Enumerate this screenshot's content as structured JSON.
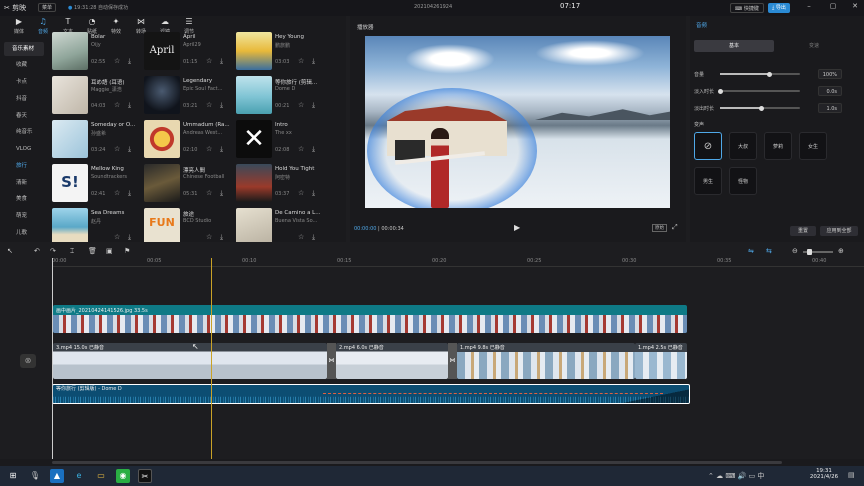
{
  "titlebar": {
    "app_name": "剪映",
    "menu_label": "菜单",
    "autosave": "19:31:28 自动保存成功",
    "project_name": "202104261924",
    "clock": "07:17",
    "shortcuts_label": "快捷键",
    "export_label": "导出",
    "accent": "#2a8ad4"
  },
  "media_tabs": [
    {
      "label": "媒体",
      "icon": "media-icon"
    },
    {
      "label": "音频",
      "icon": "audio-icon"
    },
    {
      "label": "文本",
      "icon": "text-icon"
    },
    {
      "label": "贴纸",
      "icon": "sticker-icon"
    },
    {
      "label": "特效",
      "icon": "effects-icon"
    },
    {
      "label": "转场",
      "icon": "transition-icon"
    },
    {
      "label": "滤镜",
      "icon": "filter-icon"
    },
    {
      "label": "调节",
      "icon": "adjust-icon"
    }
  ],
  "categories": [
    "音乐素材",
    "收藏",
    "卡点",
    "抖音",
    "春天",
    "纯音乐",
    "VLOG",
    "旅行",
    "清新",
    "美食",
    "萌宠",
    "儿歌"
  ],
  "tracks": [
    {
      "title": "Bolar",
      "artist": "Oijy",
      "duration": "02:55"
    },
    {
      "title": "April",
      "artist": "April29",
      "duration": "01:15"
    },
    {
      "title": "Hey Young",
      "artist": "鹏旅鹏",
      "duration": "03:03"
    },
    {
      "title": "耳め語 (耳语)",
      "artist": "Maggie_潇浩",
      "duration": "04:03"
    },
    {
      "title": "Legendary",
      "artist": "Epic Soul Fact...",
      "duration": "03:21"
    },
    {
      "title": "等你旅行 (剪辑...",
      "artist": "Dome D",
      "duration": "00:21"
    },
    {
      "title": "Someday or O...",
      "artist": "孙盛希",
      "duration": "03:24"
    },
    {
      "title": "Ummadum (Ra...",
      "artist": "Andreas West...",
      "duration": "02:10"
    },
    {
      "title": "Intro",
      "artist": "The xx",
      "duration": "02:08"
    },
    {
      "title": "Mellow King",
      "artist": "Soundtrackers",
      "duration": "02:41"
    },
    {
      "title": "漂亮人間",
      "artist": "Chinese Football",
      "duration": "05:31"
    },
    {
      "title": "Hold You Tight",
      "artist": "阿密特",
      "duration": "03:37"
    },
    {
      "title": "Sea Dreams",
      "artist": "赵丹",
      "duration": ""
    },
    {
      "title": "旅途",
      "artist": "BCD Studio",
      "duration": ""
    },
    {
      "title": "De Camino a L...",
      "artist": "Buena Vista So...",
      "duration": ""
    }
  ],
  "player": {
    "title": "播放器",
    "current_time": "00:00:00",
    "total_time": "00:00:34",
    "ratio_label": "原始"
  },
  "right_panel": {
    "title": "音频",
    "tabs": [
      "基本",
      "变速"
    ],
    "sliders": [
      {
        "label": "音量",
        "value_text": "100%",
        "fraction": 0.62
      },
      {
        "label": "淡入时长",
        "value_text": "0.0s",
        "fraction": 0.0
      },
      {
        "label": "淡出时长",
        "value_text": "1.0s",
        "fraction": 0.52
      }
    ],
    "voice_label": "变声",
    "voice_options": [
      "⊘",
      "大叔",
      "萝莉",
      "女生",
      "男生",
      "怪物"
    ],
    "reset_label": "重置",
    "apply_all_label": "应用到全部"
  },
  "timeline": {
    "ticks": [
      "00:00",
      "00:05",
      "00:10",
      "00:15",
      "00:20",
      "00:25",
      "00:30",
      "00:35",
      "00:40"
    ],
    "overlay_clip_label": "画中画片_20210424141526.jpg",
    "overlay_clip_duration": "33.5s",
    "main_clips": [
      {
        "name": "3.mp4",
        "duration": "15.0s",
        "muted": "已静音"
      },
      {
        "name": "2.mp4",
        "duration": "6.0s",
        "muted": "已静音"
      },
      {
        "name": "1.mp4",
        "duration": "9.8s",
        "muted": "已静音"
      },
      {
        "name": "1.mp4",
        "duration": "2.5s",
        "muted": "已静音"
      }
    ],
    "audio_clip_label": "等你旅行 (剪辑版) - Dome D"
  },
  "taskbar": {
    "time": "19:31",
    "date": "2021/4/26"
  }
}
